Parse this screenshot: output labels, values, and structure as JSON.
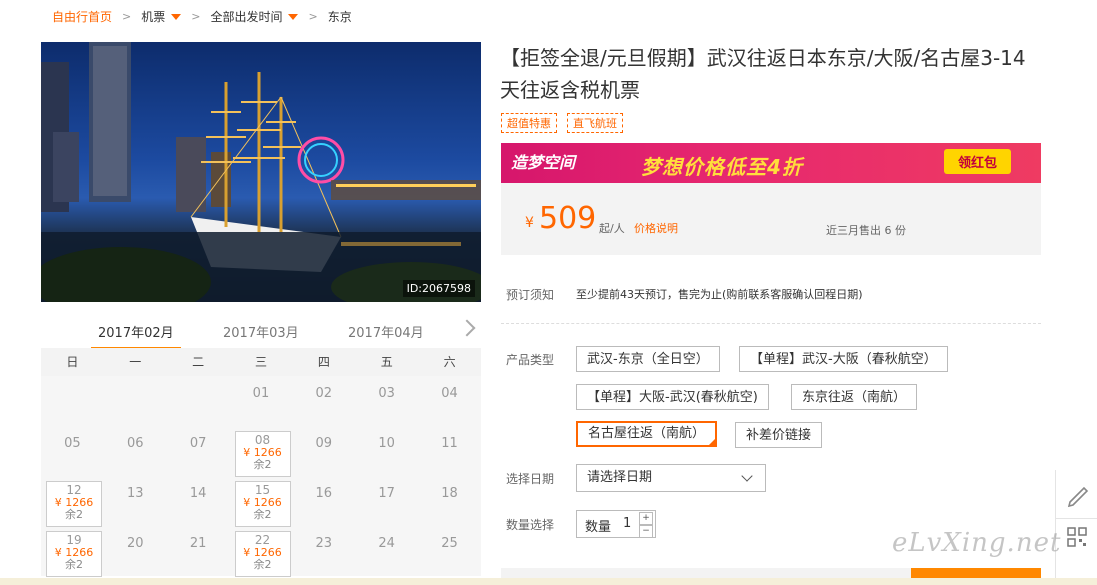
{
  "breadcrumb": {
    "home": "自由行首页",
    "item1": "机票",
    "item2": "全部出发时间",
    "item3": "东京"
  },
  "photo": {
    "id_label": "ID:2067598"
  },
  "calendar": {
    "tabs": [
      "2017年02月",
      "2017年03月",
      "2017年04月"
    ],
    "weekdays": [
      "日",
      "一",
      "二",
      "三",
      "四",
      "五",
      "六"
    ],
    "days": [
      {
        "d": "",
        "p": "",
        "s": ""
      },
      {
        "d": "",
        "p": "",
        "s": ""
      },
      {
        "d": "",
        "p": "",
        "s": ""
      },
      {
        "d": "01",
        "p": "",
        "s": ""
      },
      {
        "d": "02",
        "p": "",
        "s": ""
      },
      {
        "d": "03",
        "p": "",
        "s": ""
      },
      {
        "d": "04",
        "p": "",
        "s": ""
      },
      {
        "d": "05",
        "p": "",
        "s": ""
      },
      {
        "d": "06",
        "p": "",
        "s": ""
      },
      {
        "d": "07",
        "p": "",
        "s": ""
      },
      {
        "d": "08",
        "p": "¥ 1266",
        "s": "余2"
      },
      {
        "d": "09",
        "p": "",
        "s": ""
      },
      {
        "d": "10",
        "p": "",
        "s": ""
      },
      {
        "d": "11",
        "p": "",
        "s": ""
      },
      {
        "d": "12",
        "p": "¥ 1266",
        "s": "余2"
      },
      {
        "d": "13",
        "p": "",
        "s": ""
      },
      {
        "d": "14",
        "p": "",
        "s": ""
      },
      {
        "d": "15",
        "p": "¥ 1266",
        "s": "余2"
      },
      {
        "d": "16",
        "p": "",
        "s": ""
      },
      {
        "d": "17",
        "p": "",
        "s": ""
      },
      {
        "d": "18",
        "p": "",
        "s": ""
      },
      {
        "d": "19",
        "p": "¥ 1266",
        "s": "余2"
      },
      {
        "d": "20",
        "p": "",
        "s": ""
      },
      {
        "d": "21",
        "p": "",
        "s": ""
      },
      {
        "d": "22",
        "p": "¥ 1266",
        "s": "余2"
      },
      {
        "d": "23",
        "p": "",
        "s": ""
      },
      {
        "d": "24",
        "p": "",
        "s": ""
      },
      {
        "d": "25",
        "p": "",
        "s": ""
      }
    ]
  },
  "product": {
    "title": "【拒签全退/元旦假期】武汉往返日本东京/大阪/名古屋3-14天往返含税机票",
    "tags": [
      "超值特惠",
      "直飞航班"
    ]
  },
  "banner": {
    "logo": "造梦空间",
    "slogan": "梦想价格低至4折",
    "button": "领红包"
  },
  "price": {
    "currency": "¥",
    "amount": "509",
    "per": "起/人",
    "explain_link": "价格说明",
    "sold": "近三月售出 6 份"
  },
  "notice": {
    "label": "预订须知",
    "text": "至少提前43天预订，售完为止(购前联系客服确认回程日期)"
  },
  "options": {
    "label": "产品类型",
    "items": [
      "武汉-东京（全日空）",
      "【单程】武汉-大阪（春秋航空）",
      "【单程】大阪-武汉(春秋航空)",
      "东京往返（南航）",
      "名古屋往返（南航）",
      "补差价链接"
    ]
  },
  "date": {
    "label": "选择日期",
    "placeholder": "请选择日期"
  },
  "quantity": {
    "label": "数量选择",
    "field_label": "数量",
    "value": "1",
    "plus": "+",
    "minus": "−"
  },
  "watermark": "eLvXing.net"
}
